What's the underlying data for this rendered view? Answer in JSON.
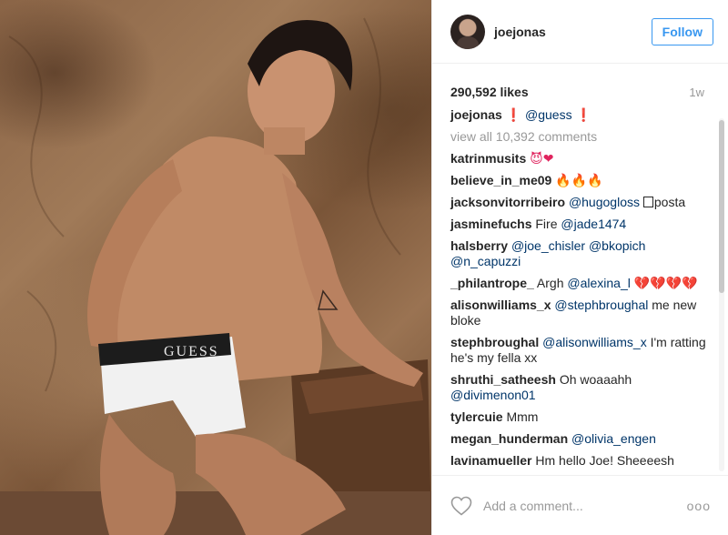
{
  "post": {
    "account": {
      "username": "joejonas",
      "follow_label": "Follow"
    },
    "likes": "290,592 likes",
    "time_ago": "1w",
    "caption": {
      "user": "joejonas",
      "mark1": "❗",
      "mention": "@guess",
      "mark2": "❗"
    },
    "view_all": "view all 10,392 comments",
    "comments": [
      {
        "user": "katrinmusits",
        "text": "😈❤"
      },
      {
        "user": "believe_in_me09",
        "text": "🔥🔥🔥"
      },
      {
        "user": "jacksonvitorribeiro",
        "mention": "@hugogloss",
        "text": "posta"
      },
      {
        "user": "jasminefuchs",
        "text": "Fire",
        "mention": "@jade1474"
      },
      {
        "user": "halsberry",
        "mention": "@joe_chisler @bkopich @n_capuzzi"
      },
      {
        "user": "_philantrope_",
        "text": "Argh",
        "mention": "@alexina_l",
        "emoji": "💔💔💔💔"
      },
      {
        "user": "alisonwilliams_x",
        "mention": "@stephbroughal",
        "text": "me new bloke"
      },
      {
        "user": "stephbroughal",
        "mention": "@alisonwilliams_x",
        "text": "I'm ratting he's my fella xx"
      },
      {
        "user": "shruthi_satheesh",
        "text": "Oh woaaahh",
        "mention": "@divimenon01"
      },
      {
        "user": "tylercuie",
        "text": "Mmm"
      },
      {
        "user": "megan_hunderman",
        "mention": "@olivia_engen"
      },
      {
        "user": "lavinamueller",
        "text": "Hm hello Joe! Sheeeesh"
      }
    ],
    "add_comment_placeholder": "Add a comment...",
    "more_label": "ooo",
    "brand_band": "GUESS"
  }
}
